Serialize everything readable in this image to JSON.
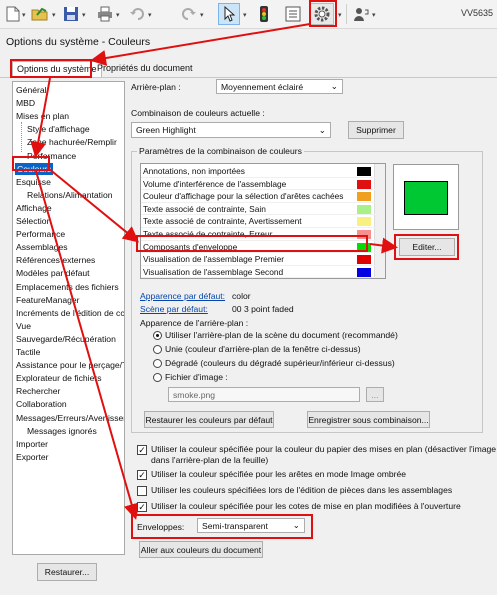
{
  "toolbar": {
    "user_label": "VV5635",
    "icons": [
      "new-document-icon",
      "open-folder-icon",
      "save-icon",
      "print-icon",
      "undo-icon",
      "redo-icon",
      "select-cursor-icon",
      "traffic-light-icon",
      "file-properties-icon",
      "options-gear-icon",
      "user-help-icon"
    ]
  },
  "window_title": "Options du système - Couleurs",
  "tabs": {
    "system": "Options du système",
    "document": "Propriétés du document"
  },
  "tree": [
    {
      "label": "Général",
      "level": 1
    },
    {
      "label": "MBD",
      "level": 1
    },
    {
      "label": "Mises en plan",
      "level": 1
    },
    {
      "label": "Style d'affichage",
      "level": 2
    },
    {
      "label": "Zone hachurée/Remplir",
      "level": 2
    },
    {
      "label": "Performance",
      "level": 2
    },
    {
      "label": "Couleurs",
      "level": 1,
      "selected": true
    },
    {
      "label": "Esquisse",
      "level": 1
    },
    {
      "label": "Relations/Alimantation",
      "level": 2
    },
    {
      "label": "Affichage",
      "level": 1
    },
    {
      "label": "Sélection",
      "level": 1
    },
    {
      "label": "Performance",
      "level": 1
    },
    {
      "label": "Assemblages",
      "level": 1
    },
    {
      "label": "Références externes",
      "level": 1
    },
    {
      "label": "Modèles par défaut",
      "level": 1
    },
    {
      "label": "Emplacements des fichiers",
      "level": 1
    },
    {
      "label": "FeatureManager",
      "level": 1
    },
    {
      "label": "Incréments de l'édition de cc",
      "level": 1
    },
    {
      "label": "Vue",
      "level": 1
    },
    {
      "label": "Sauvegarde/Récupération",
      "level": 1
    },
    {
      "label": "Tactile",
      "level": 1
    },
    {
      "label": "Assistance pour le perçage/T",
      "level": 1
    },
    {
      "label": "Explorateur de fichiers",
      "level": 1
    },
    {
      "label": "Rechercher",
      "level": 1
    },
    {
      "label": "Collaboration",
      "level": 1
    },
    {
      "label": "Messages/Erreurs/Avertissem",
      "level": 1
    },
    {
      "label": "Messages ignorés",
      "level": 2
    },
    {
      "label": "Importer",
      "level": 1
    },
    {
      "label": "Exporter",
      "level": 1
    }
  ],
  "restore_button": "Restaurer...",
  "background": {
    "label": "Arrière-plan :",
    "value": "Moyennement éclairé"
  },
  "scheme": {
    "label": "Combinaison de couleurs actuelle :",
    "value": "Green Highlight",
    "delete_button": "Supprimer"
  },
  "group_title": "Paramètres de la combinaison de couleurs",
  "color_items": [
    {
      "label": "Annotations, non importées",
      "color": "#000000"
    },
    {
      "label": "Volume d'interférence de l'assemblage",
      "color": "#e01010"
    },
    {
      "label": "Couleur d'affichage pour la sélection d'arêtes cachées",
      "color": "#f0a020"
    },
    {
      "label": "Texte associé de contrainte, Sain",
      "color": "#a8f088"
    },
    {
      "label": "Texte associé de contrainte, Avertissement",
      "color": "#f8f080"
    },
    {
      "label": "Texte associé de contrainte, Erreur",
      "color": "#f89090"
    },
    {
      "label": "Composants d'enveloppe",
      "color": "#00dd00"
    },
    {
      "label": "Visualisation de l'assemblage Premier",
      "color": "#e00000"
    },
    {
      "label": "Visualisation de l'assemblage Second",
      "color": "#0000e0"
    }
  ],
  "edit_button": "Editer...",
  "defaults": {
    "appearance_link": "Apparence par défaut:",
    "appearance_value": "color",
    "scene_link": "Scène par défaut:",
    "scene_value": "00 3 point faded"
  },
  "bg_appearance_label": "Apparence de l'arrière-plan :",
  "radios": [
    {
      "label": "Utiliser l'arrière-plan de la scène du document (recommandé)",
      "checked": true
    },
    {
      "label": "Unie (couleur d'arrière-plan de la fenêtre ci-dessus)",
      "checked": false
    },
    {
      "label": "Dégradé (couleurs du dégradé supérieur/inférieur ci-dessus)",
      "checked": false
    },
    {
      "label": "Fichier d'image :",
      "checked": false
    }
  ],
  "image_file": {
    "value": "smoke.png",
    "browse": "..."
  },
  "restore_colors_button": "Restaurer les couleurs par défaut",
  "save_scheme_button": "Enregistrer sous combinaison...",
  "checkboxes": [
    {
      "label": "Utiliser la couleur spécifiée pour la couleur du papier des mises en plan (désactiver l'image",
      "label2": "dans l'arrière-plan de la feuille)",
      "checked": true
    },
    {
      "label": "Utiliser la couleur spécifiée pour les arêtes en mode Image ombrée",
      "checked": true
    },
    {
      "label": "Utiliser les couleurs spécifiées lors de l'édition de pièces dans les assemblages",
      "checked": false
    },
    {
      "label": "Utiliser la couleur spécifiée pour les cotes de mise en plan modifiées à l'ouverture",
      "checked": true
    }
  ],
  "envelopes": {
    "label": "Enveloppes:",
    "value": "Semi-transparent"
  },
  "doc_colors_button": "Aller aux couleurs du document",
  "colors": {
    "annotation_red": "#e01010",
    "selection_blue": "#0a64c8",
    "preview_green": "#00c832"
  }
}
